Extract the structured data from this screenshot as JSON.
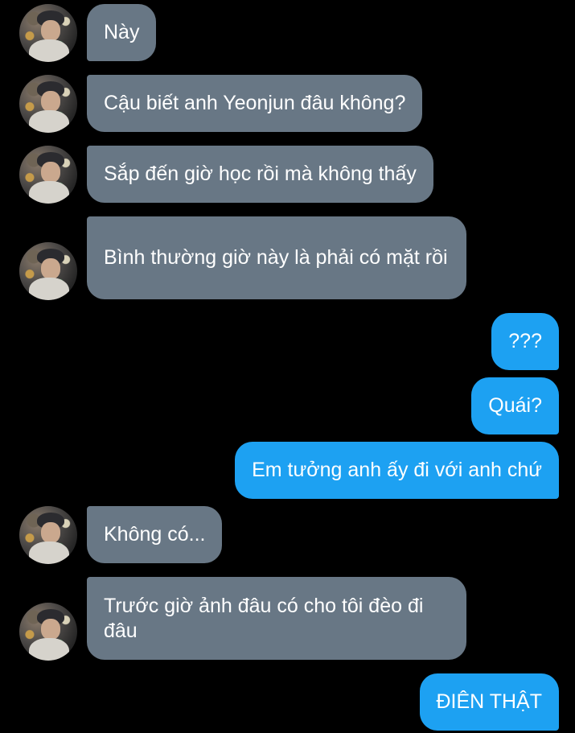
{
  "messages": [
    {
      "side": "received",
      "text": "Này",
      "avatar": true
    },
    {
      "side": "received",
      "text": "Cậu biết anh Yeonjun đâu không?",
      "avatar": true
    },
    {
      "side": "received",
      "text": "Sắp đến giờ học rồi mà không thấy",
      "avatar": true
    },
    {
      "side": "received",
      "text": "Bình thường giờ này là phải có mặt rồi",
      "avatar": true
    },
    {
      "side": "sent",
      "text": "???"
    },
    {
      "side": "sent",
      "text": "Quái?"
    },
    {
      "side": "sent",
      "text": "Em tưởng anh ấy đi với anh chứ"
    },
    {
      "side": "received",
      "text": "Không có...",
      "avatar": true
    },
    {
      "side": "received",
      "text": "Trước giờ ảnh đâu có cho tôi đèo đi đâu",
      "avatar": true
    },
    {
      "side": "sent",
      "text": "ĐIÊN THẬT"
    }
  ],
  "colors": {
    "background": "#000000",
    "received_bubble": "#687785",
    "sent_bubble": "#1da1f2",
    "text": "#ffffff"
  },
  "icons": {
    "avatar": "profile-photo-avatar"
  }
}
